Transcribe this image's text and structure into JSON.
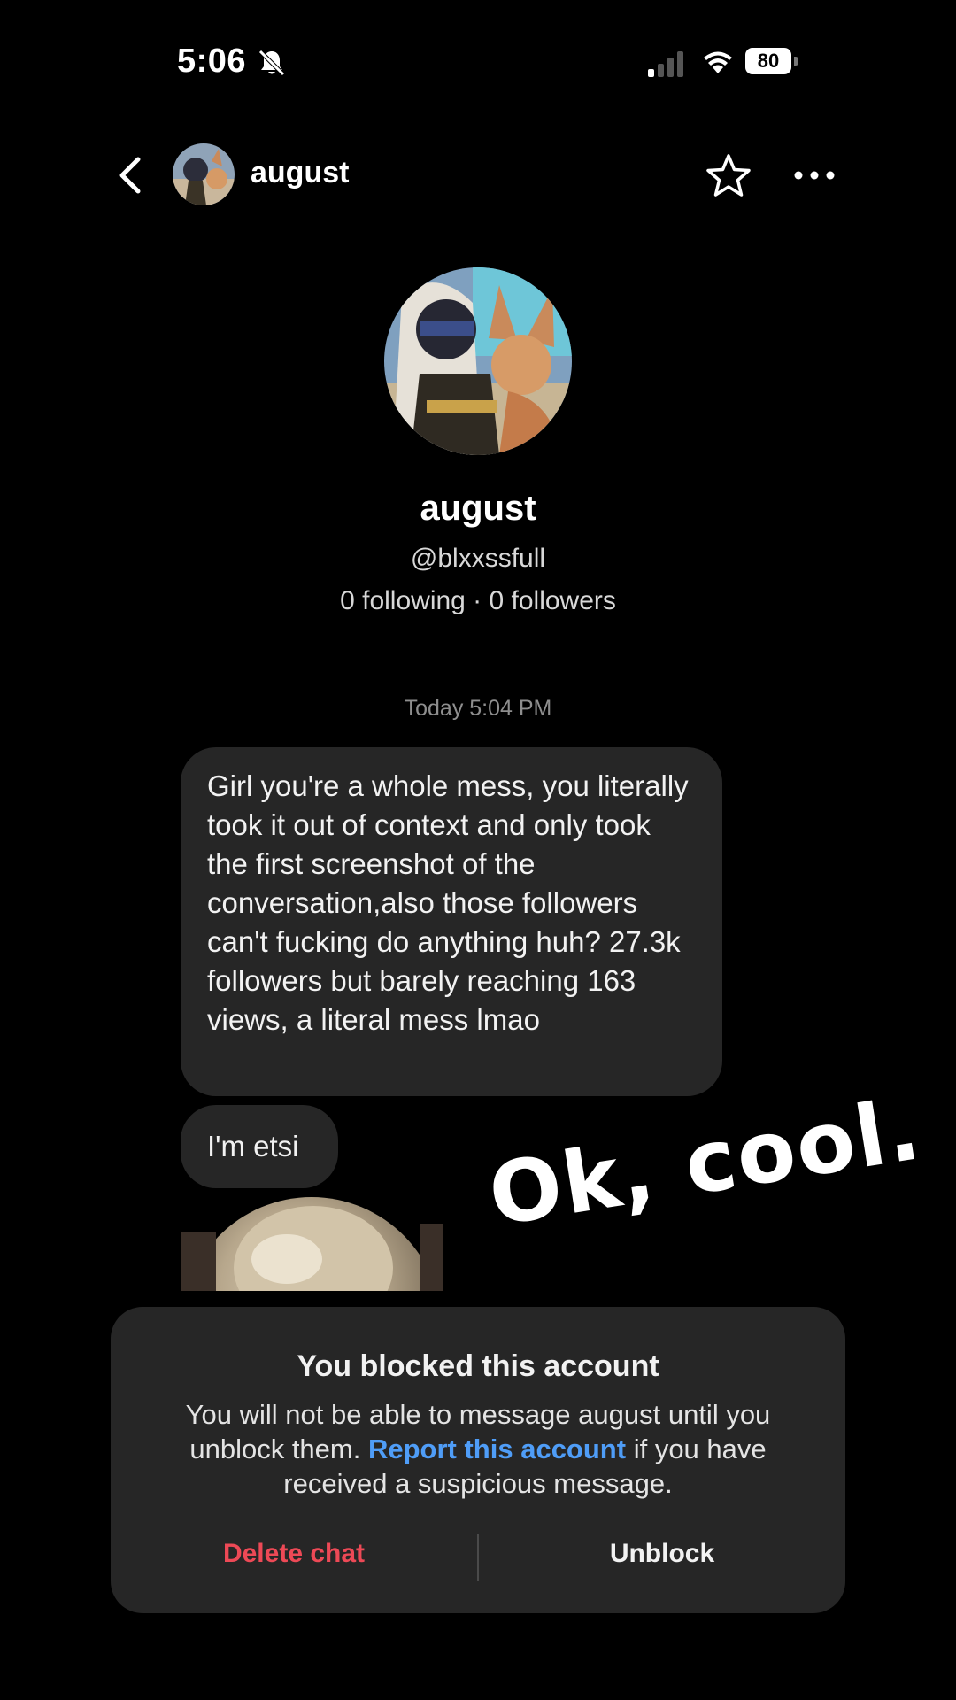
{
  "status_bar": {
    "time": "5:06",
    "battery_percent": "80",
    "signal_bars_active": 1,
    "signal_bars_total": 4,
    "icons": [
      "bell-muted-icon",
      "signal-icon",
      "wifi-icon",
      "battery-charging-icon"
    ]
  },
  "header": {
    "name": "august",
    "icons": [
      "back-chevron-icon",
      "star-icon",
      "more-dots-icon"
    ]
  },
  "profile": {
    "name": "august",
    "handle": "@blxxssfull",
    "stats": "0 following · 0 followers"
  },
  "thread": {
    "timestamp": "Today 5:04 PM",
    "messages": [
      {
        "text": "Girl you're a whole mess, you literally took it out of context and only took the first screenshot of the conversation,also those followers can't fucking do anything huh? 27.3k followers but barely reaching 163 views, a literal mess lmao"
      },
      {
        "text": "I'm etsi"
      }
    ]
  },
  "overlay_sticker": "Ok, cool.",
  "blocked_panel": {
    "title": "You blocked this account",
    "body_before": "You will not be able to message august until you unblock them.",
    "link": "Report this account",
    "body_after": "if you have received a suspicious message.",
    "delete_label": "Delete chat",
    "unblock_label": "Unblock"
  },
  "colors": {
    "background": "#000000",
    "bubble": "#262626",
    "link": "#4f9df7",
    "danger": "#ed4956"
  }
}
